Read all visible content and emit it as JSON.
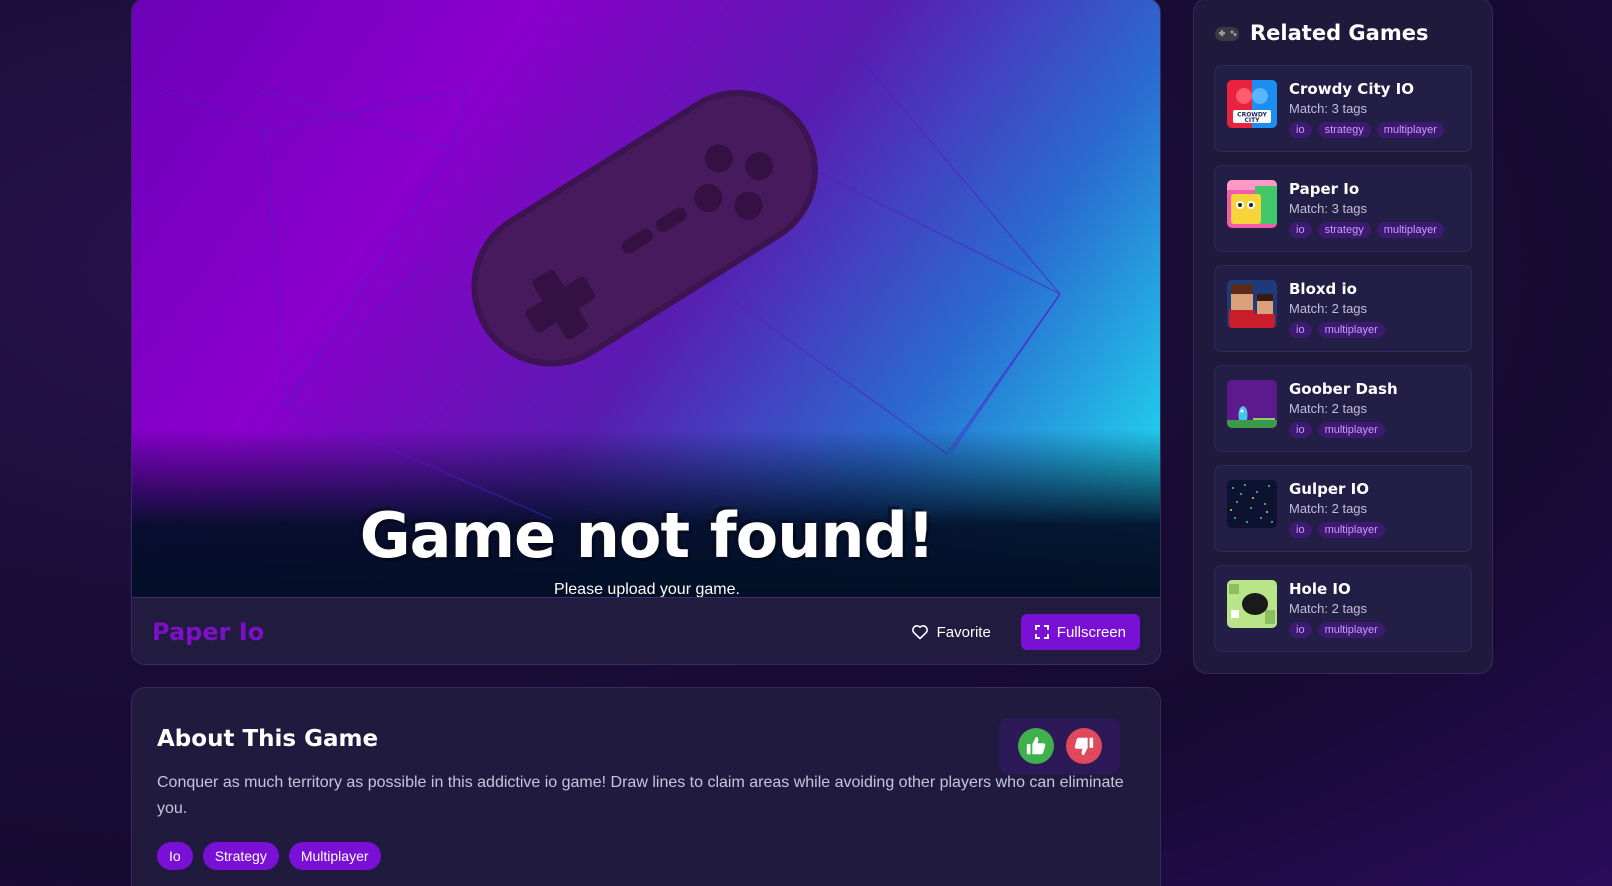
{
  "game": {
    "not_found_title": "Game not found!",
    "not_found_subtitle": "Please upload your game.",
    "name": "Paper Io",
    "favorite_label": "Favorite",
    "fullscreen_label": "Fullscreen"
  },
  "about": {
    "title": "About This Game",
    "description": "Conquer as much territory as possible in this addictive io game! Draw lines to claim areas while avoiding other players who can eliminate you.",
    "tags": [
      "Io",
      "Strategy",
      "Multiplayer"
    ]
  },
  "sidebar": {
    "icon": "gamepad-icon",
    "title": "Related Games",
    "items": [
      {
        "name": "Crowdy City IO",
        "match": "Match: 3 tags",
        "tags": [
          "io",
          "strategy",
          "multiplayer"
        ],
        "thumb_text": "CROWDY CITY",
        "colors": [
          "#e9223f",
          "#1c8ef0"
        ]
      },
      {
        "name": "Paper Io",
        "match": "Match: 3 tags",
        "tags": [
          "io",
          "strategy",
          "multiplayer"
        ],
        "colors": [
          "#f6d43a",
          "#f35ca8"
        ]
      },
      {
        "name": "Bloxd io",
        "match": "Match: 2 tags",
        "tags": [
          "io",
          "multiplayer"
        ],
        "colors": [
          "#c81e2c",
          "#1f3a78"
        ]
      },
      {
        "name": "Goober Dash",
        "match": "Match: 2 tags",
        "tags": [
          "io",
          "multiplayer"
        ],
        "colors": [
          "#5c1a8c",
          "#48c6e8"
        ]
      },
      {
        "name": "Gulper IO",
        "match": "Match: 2 tags",
        "tags": [
          "io",
          "multiplayer"
        ],
        "colors": [
          "#0d1230",
          "#2a5ad0"
        ]
      },
      {
        "name": "Hole IO",
        "match": "Match: 2 tags",
        "tags": [
          "io",
          "multiplayer"
        ],
        "colors": [
          "#b9e48a",
          "#1a1a1a"
        ]
      }
    ]
  }
}
